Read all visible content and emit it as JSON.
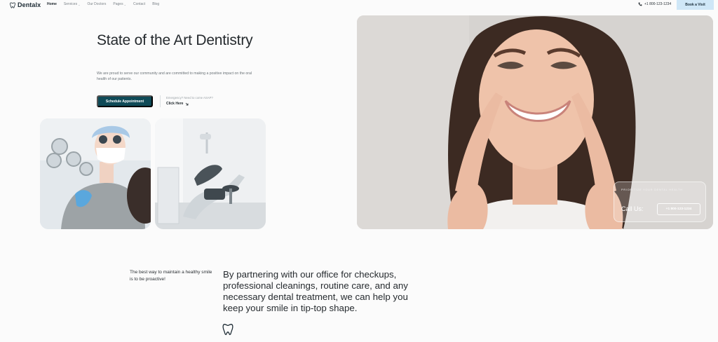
{
  "header": {
    "brand": "Dentalx",
    "nav": [
      {
        "label": "Home",
        "active": true,
        "dropdown": false
      },
      {
        "label": "Services",
        "active": false,
        "dropdown": true
      },
      {
        "label": "Our Doctors",
        "active": false,
        "dropdown": false
      },
      {
        "label": "Pages",
        "active": false,
        "dropdown": true
      },
      {
        "label": "Contact",
        "active": false,
        "dropdown": false
      },
      {
        "label": "Blog",
        "active": false,
        "dropdown": false
      }
    ],
    "phone": "+1 800-123-1234",
    "book_label": "Book a Visit"
  },
  "hero": {
    "title": "State of the Art Dentistry",
    "description": "We are proud to serve our community and are committed to making a positive impact on the oral health of our patients.",
    "cta_label": "Schedule Appointment",
    "emergency_text": "Emergency? Need to come ASAP?",
    "click_label": "Click Here"
  },
  "callcard": {
    "kicker": "PRIORITIZE YOUR DENTAL HEALTH",
    "label": "Call Us:",
    "phone": "+1 800-123-1234"
  },
  "about": {
    "tagline": "The best way to maintain a healthy smile is to be proactive!",
    "statement": "By partnering with our office for checkups, professional cleanings, routine care, and any necessary dental treatment, we can help you keep your smile in tip-top shape."
  },
  "colors": {
    "accent": "#0f4a57",
    "book_bg": "#cfe7f7",
    "page_bg": "#fbfbfb"
  },
  "icons": {
    "logo": "tooth-icon",
    "phone": "phone-icon",
    "click": "arrow-down-right-icon",
    "section": "tooth-icon"
  }
}
